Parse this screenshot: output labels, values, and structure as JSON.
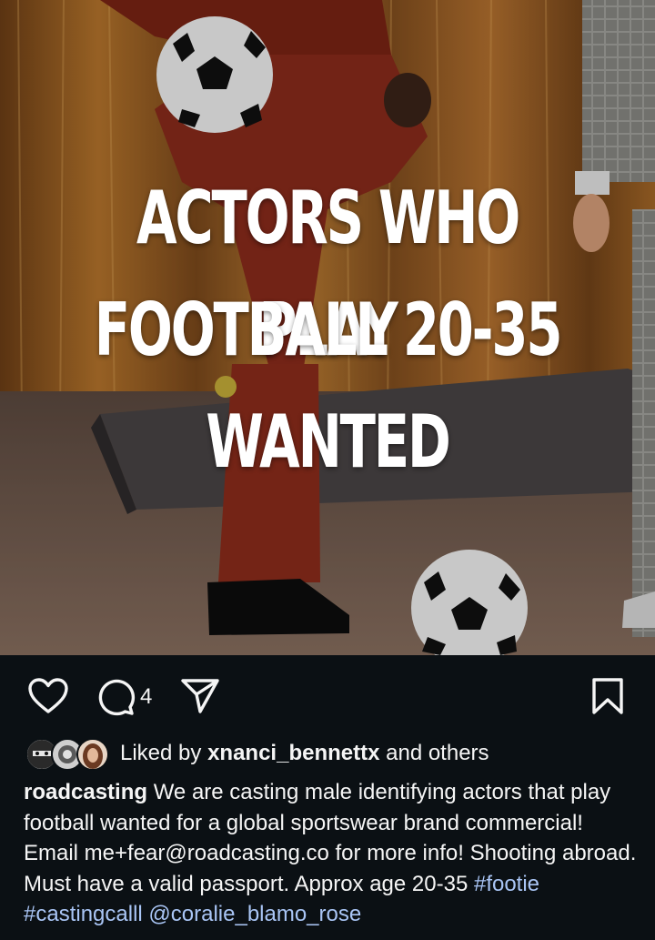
{
  "post": {
    "headline_lines": [
      "ACTORS WHO PLAY",
      "FOOTBALL 20-35",
      "WANTED"
    ]
  },
  "actions": {
    "comment_count": "4"
  },
  "likes": {
    "prefix": "Liked by",
    "user": "xnanci_bennettx",
    "suffix": "and others"
  },
  "caption": {
    "username": "roadcasting",
    "text": "We are casting male identifying actors that play football wanted for a global sportswear brand commercial! Email me+fear@roadcasting.co for more info! Shooting abroad. Must have a valid passport. Approx age 20-35",
    "tags": [
      "#footie",
      "#castingcalll",
      "@coralie_blamo_rose"
    ]
  },
  "icons": {
    "like": "heart-icon",
    "comment": "comment-icon",
    "share": "paper-plane-icon",
    "save": "bookmark-icon"
  },
  "colors": {
    "background": "#0b1014",
    "text": "#f5f5f5",
    "link": "#a9c5f5",
    "curtain": "#b8762c",
    "suit": "#8b2b1b"
  }
}
